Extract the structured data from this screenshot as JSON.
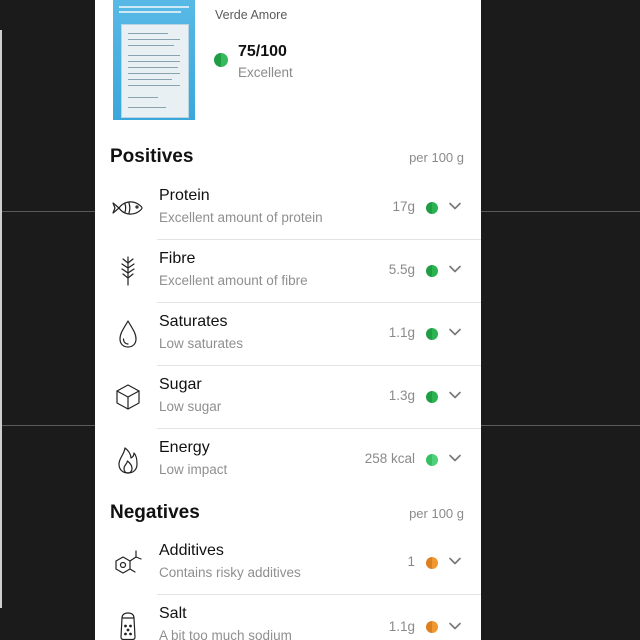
{
  "product": {
    "brand": "Verde Amore",
    "score": "75/100",
    "score_label": "Excellent"
  },
  "positives": {
    "title": "Positives",
    "per": "per 100 g",
    "items": [
      {
        "name": "Protein",
        "desc": "Excellent amount of protein",
        "value": "17g",
        "icon": "fish-icon",
        "dot": "green"
      },
      {
        "name": "Fibre",
        "desc": "Excellent amount of fibre",
        "value": "5.5g",
        "icon": "wheat-icon",
        "dot": "green"
      },
      {
        "name": "Saturates",
        "desc": "Low saturates",
        "value": "1.1g",
        "icon": "drop-icon",
        "dot": "green"
      },
      {
        "name": "Sugar",
        "desc": "Low sugar",
        "value": "1.3g",
        "icon": "cube-icon",
        "dot": "green"
      },
      {
        "name": "Energy",
        "desc": "Low impact",
        "value": "258 kcal",
        "icon": "flame-icon",
        "dot": "lightgreen"
      }
    ]
  },
  "negatives": {
    "title": "Negatives",
    "per": "per 100 g",
    "items": [
      {
        "name": "Additives",
        "desc": "Contains risky additives",
        "value": "1",
        "icon": "molecule-icon",
        "dot": "orange"
      },
      {
        "name": "Salt",
        "desc": "A bit too much sodium",
        "value": "1.1g",
        "icon": "salt-shaker-icon",
        "dot": "orange"
      }
    ]
  },
  "colors": {
    "green": "#1f9d45",
    "lightgreen": "#3cc46a",
    "orange": "#e98a2a"
  }
}
